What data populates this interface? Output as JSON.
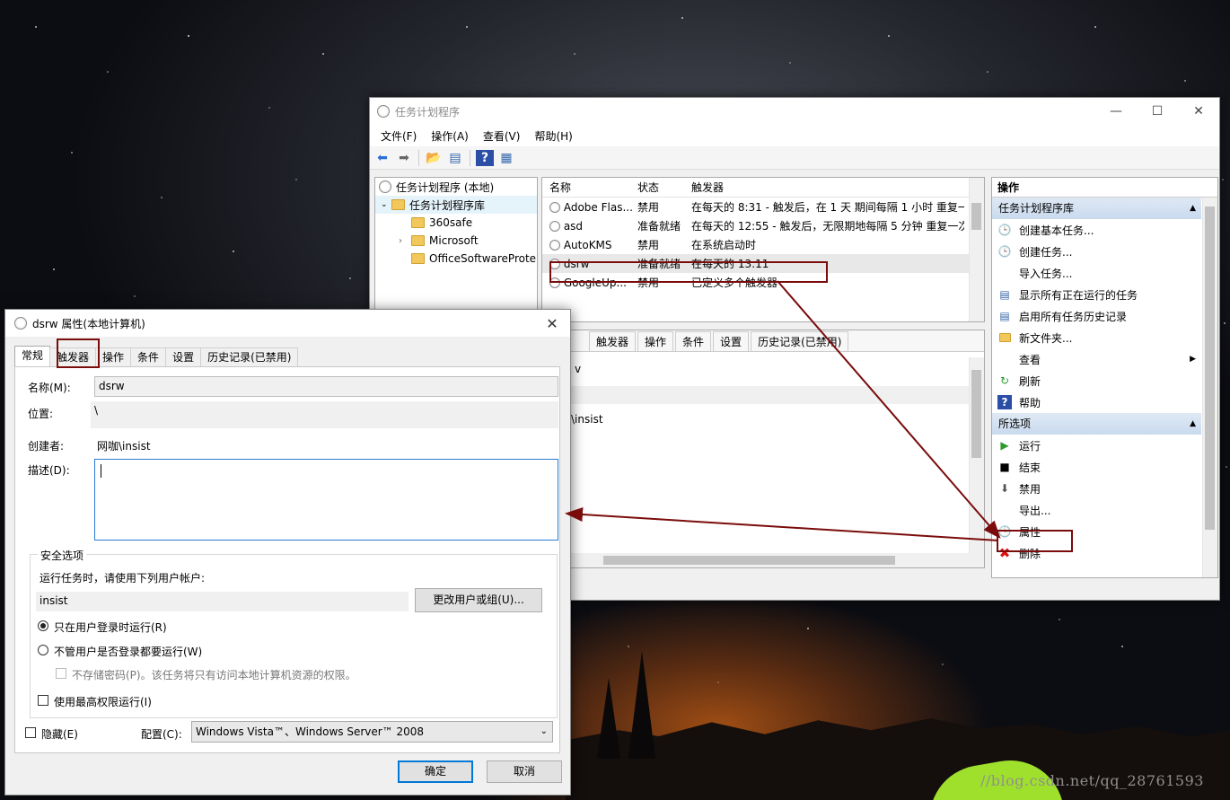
{
  "main_window": {
    "title": "任务计划程序",
    "menu": [
      "文件(F)",
      "操作(A)",
      "查看(V)",
      "帮助(H)"
    ],
    "tree": {
      "root": "任务计划程序 (本地)",
      "library": "任务计划程序库",
      "folders": [
        "360safe",
        "Microsoft",
        "OfficeSoftwareProte"
      ]
    },
    "task_list": {
      "columns": [
        "名称",
        "状态",
        "触发器"
      ],
      "rows": [
        {
          "name": "Adobe Flas...",
          "status": "禁用",
          "trigger": "在每天的 8:31 - 触发后，在 1 天 期间每隔 1 小时 重复一"
        },
        {
          "name": "asd",
          "status": "准备就绪",
          "trigger": "在每天的 12:55 - 触发后，无限期地每隔 5 分钟 重复一次"
        },
        {
          "name": "AutoKMS",
          "status": "禁用",
          "trigger": "在系统启动时"
        },
        {
          "name": "dsrw",
          "status": "准备就绪",
          "trigger": "在每天的 13:11"
        },
        {
          "name": "GoogleUp...",
          "status": "禁用",
          "trigger": "已定义多个触发器"
        }
      ]
    },
    "detail_tabs": [
      "触发器",
      "操作",
      "条件",
      "设置",
      "历史记录(已禁用)"
    ],
    "detail_fragments": [
      "v",
      "\\insist"
    ],
    "actions": {
      "header": "操作",
      "section1": "任务计划程序库",
      "items1": [
        "创建基本任务...",
        "创建任务...",
        "导入任务...",
        "显示所有正在运行的任务",
        "启用所有任务历史记录",
        "新文件夹...",
        "查看",
        "刷新",
        "帮助"
      ],
      "section2": "所选项",
      "items2": [
        "运行",
        "结束",
        "禁用",
        "导出...",
        "属性",
        "删除"
      ]
    }
  },
  "dialog": {
    "title": "dsrw 属性(本地计算机)",
    "tabs": [
      "常规",
      "触发器",
      "操作",
      "条件",
      "设置",
      "历史记录(已禁用)"
    ],
    "name_label": "名称(M):",
    "name_value": "dsrw",
    "location_label": "位置:",
    "location_value": "\\",
    "author_label": "创建者:",
    "author_value": "网咖\\insist",
    "desc_label": "描述(D):",
    "security_title": "安全选项",
    "run_as_label": "运行任务时，请使用下列用户帐户:",
    "run_as_user": "insist",
    "change_user_button": "更改用户或组(U)...",
    "radio_logged_on": "只在用户登录时运行(R)",
    "radio_whether": "不管用户是否登录都要运行(W)",
    "no_store_pwd": "不存储密码(P)。该任务将只有访问本地计算机资源的权限。",
    "highest_priv": "使用最高权限运行(I)",
    "hidden": "隐藏(E)",
    "config_label": "配置(C):",
    "config_value": "Windows Vista™、Windows Server™ 2008",
    "ok": "确定",
    "cancel": "取消"
  },
  "watermark": "//blog.csdn.net/qq_28761593",
  "colors": {
    "annotation": "#7a0c0c",
    "section_header": "#c9daee",
    "accent": "#0078d7"
  }
}
